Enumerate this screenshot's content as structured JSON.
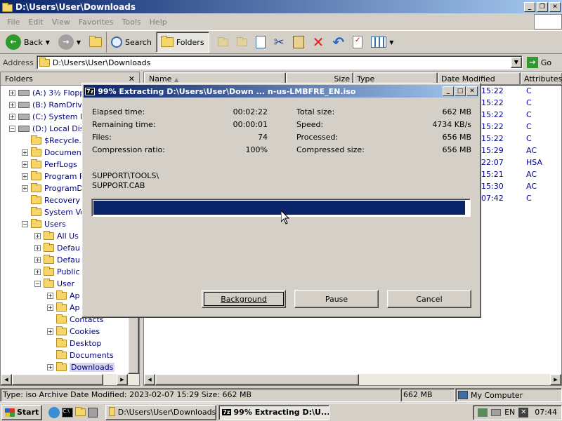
{
  "window": {
    "title": "D:\\Users\\User\\Downloads"
  },
  "menu": [
    "File",
    "Edit",
    "View",
    "Favorites",
    "Tools",
    "Help"
  ],
  "toolbar": {
    "back": "Back",
    "search": "Search",
    "folders": "Folders"
  },
  "address": {
    "label": "Address",
    "value": "D:\\Users\\User\\Downloads",
    "go": "Go"
  },
  "folders_pane": {
    "title": "Folders",
    "items": [
      {
        "label": "(A:) 3½ Floppy"
      },
      {
        "label": "(B:) RamDrive"
      },
      {
        "label": "(C:) System Re"
      },
      {
        "label": "(D:) Local Disk"
      },
      {
        "label": "$Recycle."
      },
      {
        "label": "Documen"
      },
      {
        "label": "PerfLogs"
      },
      {
        "label": "Program F"
      },
      {
        "label": "ProgramD"
      },
      {
        "label": "Recovery"
      },
      {
        "label": "System Vo"
      },
      {
        "label": "Users"
      },
      {
        "label": "All Us"
      },
      {
        "label": "Defau"
      },
      {
        "label": "Defau"
      },
      {
        "label": "Public"
      },
      {
        "label": "User"
      },
      {
        "label": "Ap"
      },
      {
        "label": "Ap"
      },
      {
        "label": "Contacts"
      },
      {
        "label": "Cookies"
      },
      {
        "label": "Desktop"
      },
      {
        "label": "Documents"
      },
      {
        "label": "Downloads"
      }
    ]
  },
  "columns": {
    "name": "Name",
    "size": "Size",
    "type": "Type",
    "date": "Date Modified",
    "attr": "Attributes"
  },
  "file_rows": [
    {
      "time": "15:22",
      "attr": "C"
    },
    {
      "time": "15:22",
      "attr": "C"
    },
    {
      "time": "15:22",
      "attr": "C"
    },
    {
      "time": "15:22",
      "attr": "C"
    },
    {
      "time": "15:22",
      "attr": "C"
    },
    {
      "time": "15:29",
      "attr": "AC"
    },
    {
      "time": "22:07",
      "attr": "HSA"
    },
    {
      "time": "15:21",
      "attr": "AC"
    },
    {
      "time": "15:30",
      "attr": "AC"
    },
    {
      "time": "07:42",
      "attr": "C"
    }
  ],
  "dialog": {
    "title": "99% Extracting D:\\Users\\User\\Down ... n-us-LMBFRE_EN.iso",
    "left": [
      {
        "label": "Elapsed time:",
        "value": "00:02:22"
      },
      {
        "label": "Remaining time:",
        "value": "00:00:01"
      },
      {
        "label": "Files:",
        "value": "74"
      },
      {
        "label": "Compression ratio:",
        "value": "100%"
      }
    ],
    "right": [
      {
        "label": "Total size:",
        "value": "662 MB"
      },
      {
        "label": "Speed:",
        "value": "4734 KB/s"
      },
      {
        "label": "Processed:",
        "value": "656 MB"
      },
      {
        "label": "Compressed size:",
        "value": "656 MB"
      }
    ],
    "current_path": "SUPPORT\\TOOLS\\",
    "current_file": "SUPPORT.CAB",
    "progress": 0.99,
    "buttons": {
      "background": "Background",
      "pause": "Pause",
      "cancel": "Cancel"
    }
  },
  "status": {
    "info": "Type: iso Archive Date Modified: 2023-02-07 15:29 Size: 662 MB",
    "size": "662 MB",
    "location": "My Computer"
  },
  "taskbar": {
    "start": "Start",
    "task1": "D:\\Users\\User\\Downloads",
    "task2": "99% Extracting D:\\U...",
    "lang": "EN",
    "clock": "07:44"
  },
  "colors": {
    "titlebar": "#0a246a",
    "progress": "#0a246a",
    "link": "#0000a0"
  }
}
